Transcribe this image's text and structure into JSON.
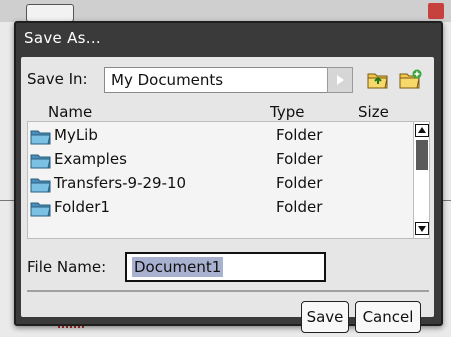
{
  "dialog": {
    "title": "Save As...",
    "save_in_label": "Save In:",
    "save_in_value": "My Documents",
    "icons": [
      "folder-up-icon",
      "new-folder-icon"
    ],
    "columns": {
      "name": "Name",
      "type": "Type",
      "size": "Size"
    },
    "rows": [
      {
        "name": "MyLib",
        "type": "Folder",
        "size": ""
      },
      {
        "name": "Examples",
        "type": "Folder",
        "size": ""
      },
      {
        "name": "Transfers-9-29-10",
        "type": "Folder",
        "size": ""
      },
      {
        "name": "Folder1",
        "type": "Folder",
        "size": ""
      }
    ],
    "file_name_label": "File Name:",
    "file_name_value": "Document1",
    "save_button": "Save",
    "cancel_button": "Cancel"
  },
  "colors": {
    "dialog_frame": "#3a3a3a",
    "content_bg": "#e6e6e6",
    "selection": "#a8b2d0",
    "folder_icon": "#5ea3c9"
  }
}
